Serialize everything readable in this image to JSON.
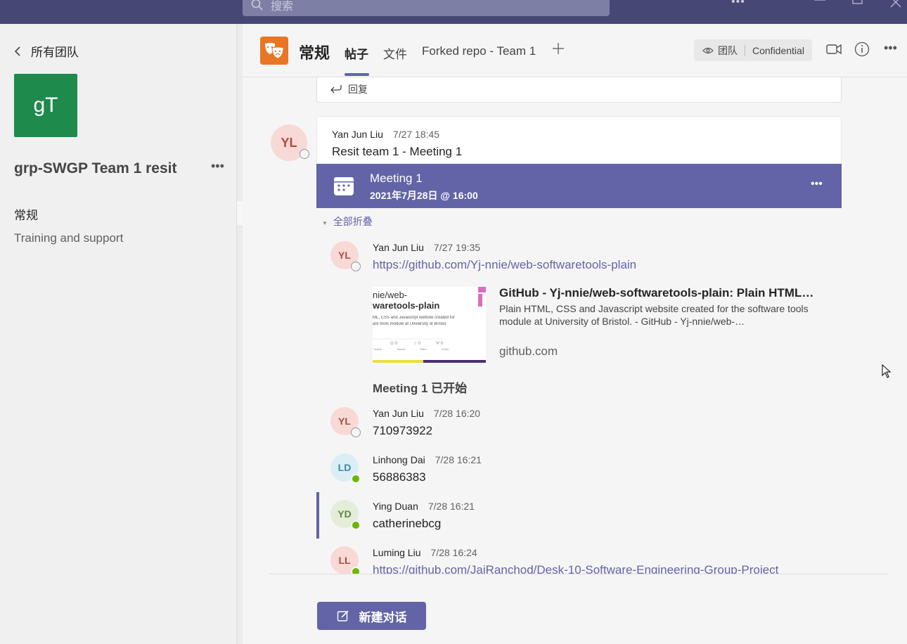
{
  "search": {
    "placeholder": "搜索"
  },
  "left": {
    "back_label": "所有团队",
    "team_initials": "gT",
    "team_name": "grp-SWGP Team 1 resit",
    "channels": [
      {
        "label": "常规"
      },
      {
        "label": "Training and support"
      }
    ]
  },
  "header": {
    "channel_title": "常规",
    "tabs": [
      {
        "label": "帖子"
      },
      {
        "label": "文件"
      },
      {
        "label": "Forked repo - Team 1"
      }
    ],
    "team_label": "团队",
    "confidential_label": "Confidential"
  },
  "thread": {
    "reply_label": "回复",
    "author": "Yan Jun Liu",
    "avatar": "YL",
    "time": "7/27 18:45",
    "subject": "Resit team 1 - Meeting 1",
    "meeting_title": "Meeting 1",
    "meeting_time": "2021年7月28日 @ 16:00",
    "collapse_label": "全部折叠",
    "link_preview": {
      "image_text": [
        "nie/web-",
        "waretools-plain",
        "ML, CSS and Javascript website created for",
        "are tools module at University of Bristol."
      ],
      "title": "GitHub - Yj-nnie/web-softwaretools-plain: Plain HTML…",
      "description": "Plain HTML, CSS and Javascript website created for the software tools module at University of Bristol. - GitHub - Yj-nnie/web-…",
      "domain": "github.com"
    },
    "started_label": "Meeting 1 已开始",
    "replies": [
      {
        "avatar": "YL",
        "author": "Yan Jun Liu",
        "time": "7/27 19:35",
        "text": "https://github.com/Yj-nnie/web-softwaretools-plain",
        "is_link": true
      },
      {
        "avatar": "YL",
        "author": "Yan Jun Liu",
        "time": "7/28 16:20",
        "text": "710973922"
      },
      {
        "avatar": "LD",
        "author": "Linhong Dai",
        "time": "7/28 16:21",
        "text": "56886383"
      },
      {
        "avatar": "YD",
        "author": "Ying Duan",
        "time": "7/28 16:21",
        "text": "catherinebcg"
      },
      {
        "avatar": "LL",
        "author": "Luming Liu",
        "time": "7/28 16:24",
        "text": "https://github.com/JaiRanchod/Desk-10-Software-Engineering-Group-Project",
        "is_link": true
      }
    ]
  },
  "new_conversation_label": "新建对话",
  "colors": {
    "accent": "#6264a7",
    "titlebar": "#464775",
    "team_tile": "#1e8a4c",
    "app_icon": "#e87624",
    "presence_available": "#6bb700"
  }
}
